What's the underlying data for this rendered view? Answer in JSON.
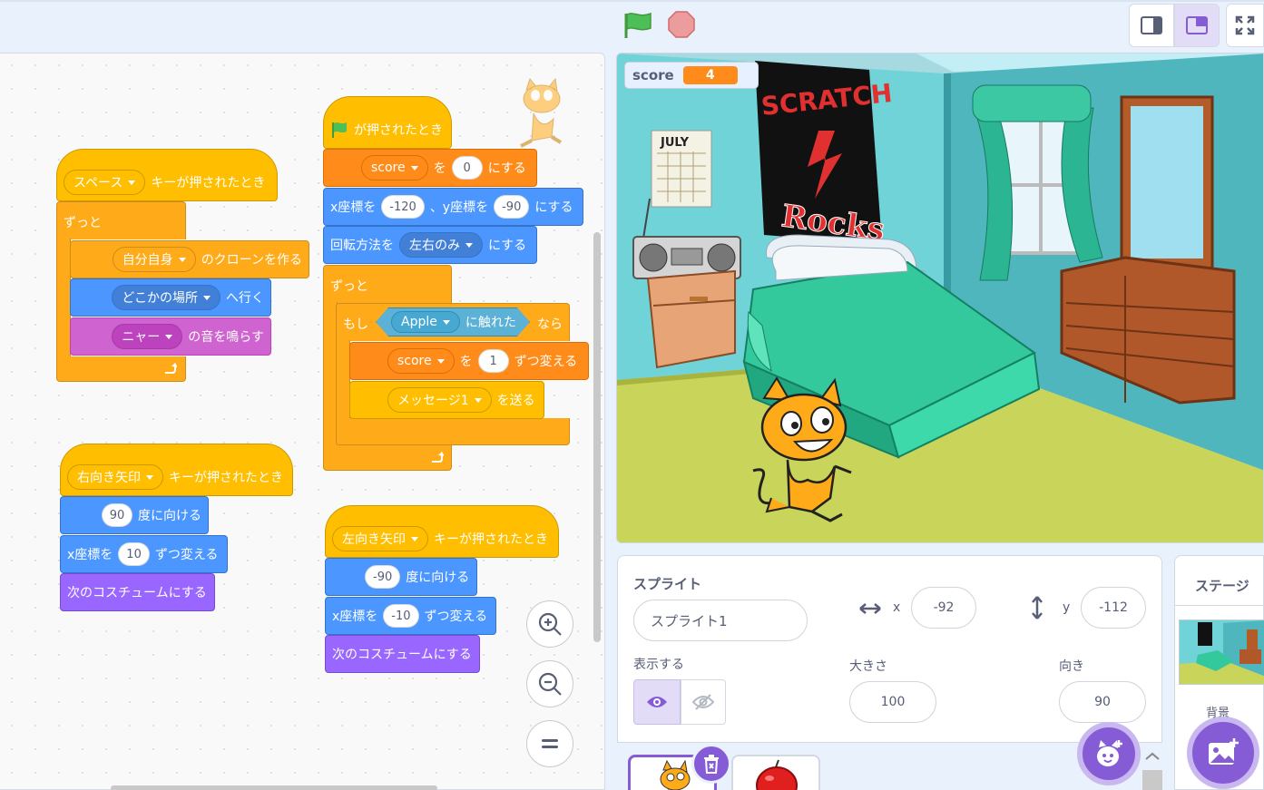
{
  "toolbar": {
    "green_flag": "green-flag-icon",
    "stop": "stop-sign-icon"
  },
  "scripts": {
    "space_script": {
      "hat_key": "スペース",
      "hat_text": "キーが押されたとき",
      "forever": "ずっと",
      "clone_target": "自分自身",
      "clone_text": "のクローンを作る",
      "goto_target": "どこかの場所",
      "goto_text": "へ行く",
      "sound_name": "ニャー",
      "sound_text": "の音を鳴らす"
    },
    "flag_script": {
      "hat_text": "が押されたとき",
      "set_var": "score",
      "set_to": "を",
      "set_value": "0",
      "set_end": "にする",
      "x_label": "x座標を",
      "x_value": "-120",
      "y_label": "、y座標を",
      "y_value": "-90",
      "xy_end": "にする",
      "rot_label": "回転方法を",
      "rot_value": "左右のみ",
      "rot_end": "にする",
      "forever": "ずっと",
      "if_label": "もし",
      "touch_target": "Apple",
      "touch_text": "に触れた",
      "then": "なら",
      "change_var": "score",
      "change_by_label": "を",
      "change_value": "1",
      "change_end": "ずつ変える",
      "broadcast_msg": "メッセージ1",
      "broadcast_text": "を送る"
    },
    "right_script": {
      "hat_key": "右向き矢印",
      "hat_text": "キーが押されたとき",
      "dir_value": "90",
      "dir_text": "度に向ける",
      "x_label": "x座標を",
      "x_value": "10",
      "x_text": "ずつ変える",
      "costume": "次のコスチュームにする"
    },
    "left_script": {
      "hat_key": "左向き矢印",
      "hat_text": "キーが押されたとき",
      "dir_value": "-90",
      "dir_text": "度に向ける",
      "x_label": "x座標を",
      "x_value": "-10",
      "x_text": "ずつ変える",
      "costume": "次のコスチュームにする"
    }
  },
  "zoom": {
    "zoom_in": "+",
    "zoom_out": "−",
    "reset": "="
  },
  "stage": {
    "monitor_label": "score",
    "monitor_value": "4",
    "poster_line1": "SCRATCH",
    "poster_line2": "Rocks",
    "calendar_text": "JULY"
  },
  "sprite_info": {
    "title": "スプライト",
    "name": "スプライト1",
    "x_label": "x",
    "x_value": "-92",
    "y_label": "y",
    "y_value": "-112",
    "show_label": "表示する",
    "size_label": "大きさ",
    "size_value": "100",
    "direction_label": "向き",
    "direction_value": "90"
  },
  "stage_pane": {
    "title": "ステージ",
    "backdrop_label": "背景"
  },
  "colors": {
    "accent": "#855cd6",
    "events": "#ffbf00",
    "control": "#ffab19",
    "motion": "#4c97ff",
    "looks": "#9966ff",
    "sound": "#cf63cf",
    "variables": "#ff8c1a",
    "sensing": "#5cb1d6"
  }
}
